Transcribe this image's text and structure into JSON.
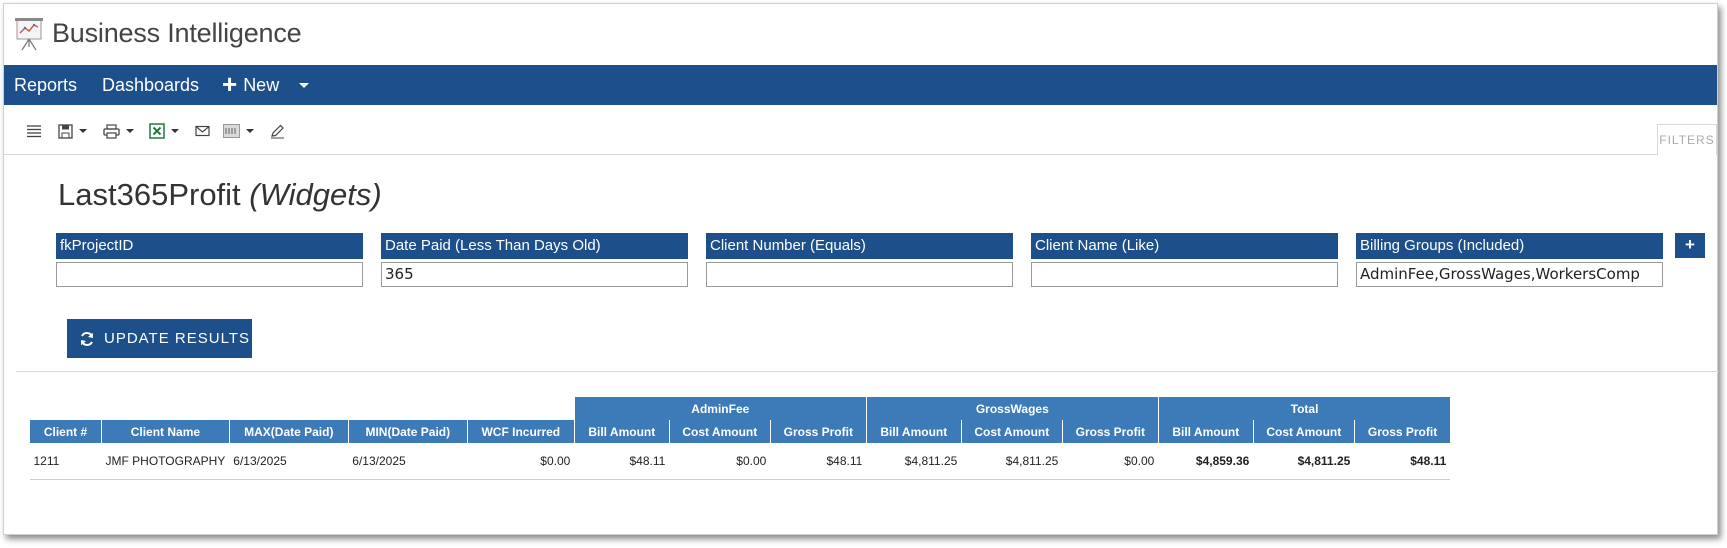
{
  "app": {
    "title": "Business Intelligence"
  },
  "nav": {
    "reports": "Reports",
    "dashboards": "Dashboards",
    "new": "New"
  },
  "toolbar": {
    "filters_tab": "FILTERS"
  },
  "report": {
    "name": "Last365Profit",
    "subtitle": "(Widgets)"
  },
  "filters": [
    {
      "label": "fkProjectID",
      "value": ""
    },
    {
      "label": "Date Paid (Less Than Days Old)",
      "value": "365"
    },
    {
      "label": "Client Number (Equals)",
      "value": ""
    },
    {
      "label": "Client Name (Like)",
      "value": ""
    },
    {
      "label": "Billing Groups (Included)",
      "value": "AdminFee,GrossWages,WorkersComp"
    }
  ],
  "add_filter_label": "+",
  "update_button": "UPDATE RESULTS",
  "table": {
    "groups": [
      "AdminFee",
      "GrossWages",
      "Total"
    ],
    "columns": [
      "Client #",
      "Client Name",
      "MAX(Date Paid)",
      "MIN(Date Paid)",
      "WCF Incurred",
      "Bill Amount",
      "Cost Amount",
      "Gross Profit",
      "Bill Amount",
      "Cost Amount",
      "Gross Profit",
      "Bill Amount",
      "Cost Amount",
      "Gross Profit"
    ],
    "rows": [
      [
        "1211",
        "JMF PHOTOGRAPHY",
        "6/13/2025",
        "6/13/2025",
        "$0.00",
        "$48.11",
        "$0.00",
        "$48.11",
        "$4,811.25",
        "$4,811.25",
        "$0.00",
        "$4,859.36",
        "$4,811.25",
        "$48.11"
      ]
    ]
  }
}
